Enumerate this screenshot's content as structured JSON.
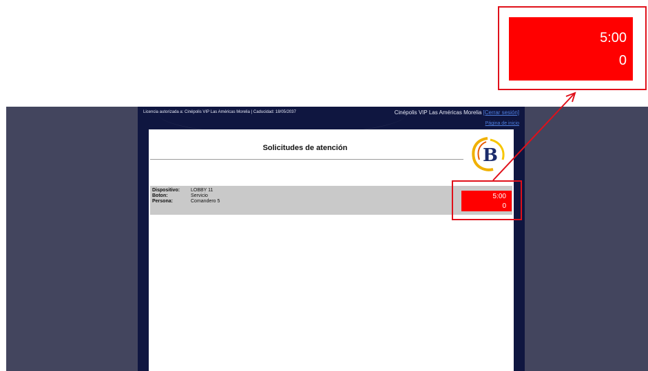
{
  "header": {
    "license": "Licencia autorizada a: Cinépolis VIP Las Américas Morelia | Caducidad: 18/05/2037",
    "site_name": "Cinépolis VIP Las Américas Morelia",
    "logout": "[Cerrar sesión]",
    "home_link": "Página de inicio"
  },
  "main": {
    "title": "Solicitudes de atención"
  },
  "logo": {
    "letter": "B",
    "colors": {
      "ring": "#f0b000",
      "letter": "#1b2b6b"
    }
  },
  "request": {
    "fields": [
      {
        "label": "Dispositivo:",
        "value": "LOBBY 11"
      },
      {
        "label": "Boton:",
        "value": "Servicio"
      },
      {
        "label": "Persona:",
        "value": "Comandero 5"
      }
    ],
    "timer": "5:00",
    "count": "0"
  },
  "zoom_callout": {
    "timer": "5:00",
    "count": "0"
  },
  "colors": {
    "background": "#ffffff",
    "side_panels": "#43455e",
    "center_frame": "#0f1640",
    "row": "#c9c9c9",
    "alert": "#ff0000",
    "highlight": "#e0101a",
    "link": "#4f7fe0"
  },
  "icons": [
    "b-logo-icon",
    "arrow-connector-icon"
  ]
}
